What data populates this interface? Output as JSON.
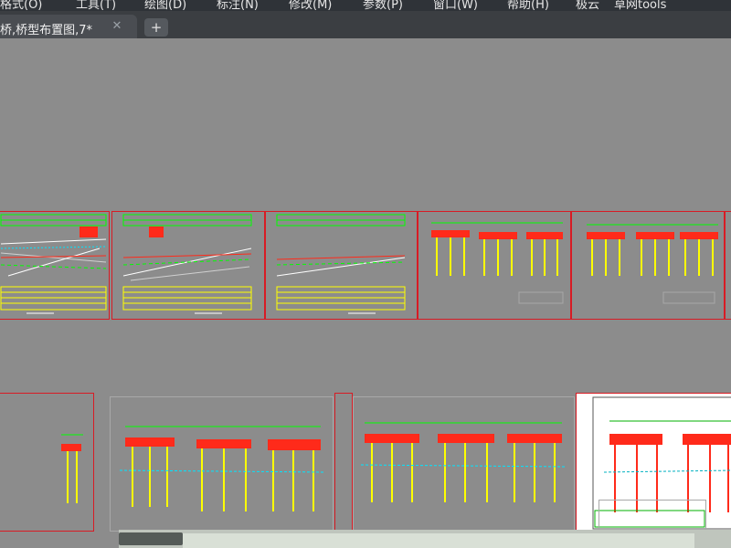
{
  "menubar": {
    "items": [
      {
        "label": "格式(O)"
      },
      {
        "label": "工具(T)"
      },
      {
        "label": "绘图(D)"
      },
      {
        "label": "标注(N)"
      },
      {
        "label": "修改(M)"
      },
      {
        "label": "参数(P)"
      },
      {
        "label": "窗口(W)"
      },
      {
        "label": "帮助(H)"
      },
      {
        "label": "极云"
      },
      {
        "label": "草网tools"
      }
    ]
  },
  "tabs": {
    "active": {
      "label": "桥,桥型布置图,7*"
    },
    "close_symbol": "✕",
    "new_symbol": "+"
  },
  "colors": {
    "background": "#8c8c8c",
    "sheet_border": "#d81b24",
    "green": "#00ff00",
    "red": "#ff2a1a",
    "yellow": "#ffff00",
    "white": "#ffffff"
  },
  "icons": {
    "tab_close": "close-icon",
    "tab_new": "plus-icon"
  }
}
